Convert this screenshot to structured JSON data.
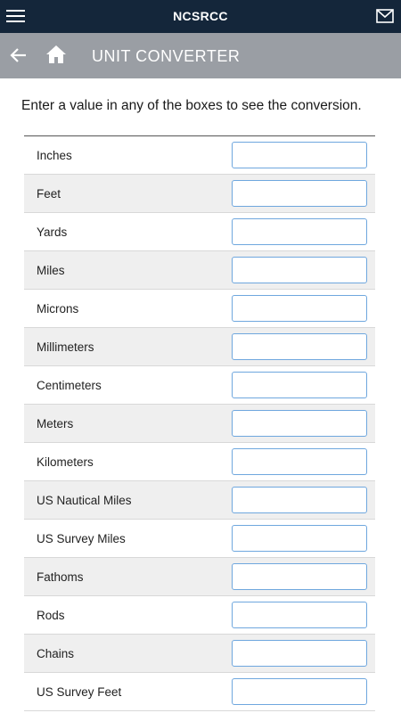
{
  "app": {
    "title": "NCSRCC",
    "menu_icon": "hamburger-icon",
    "mail_icon": "mail-icon"
  },
  "subheader": {
    "back_icon": "back-arrow-icon",
    "home_icon": "home-icon",
    "title": "UNIT CONVERTER"
  },
  "instruction": "Enter a value in any of the boxes to see the conversion.",
  "units": [
    {
      "label": "Inches",
      "value": ""
    },
    {
      "label": "Feet",
      "value": ""
    },
    {
      "label": "Yards",
      "value": ""
    },
    {
      "label": "Miles",
      "value": ""
    },
    {
      "label": "Microns",
      "value": ""
    },
    {
      "label": "Millimeters",
      "value": ""
    },
    {
      "label": "Centimeters",
      "value": ""
    },
    {
      "label": "Meters",
      "value": ""
    },
    {
      "label": "Kilometers",
      "value": ""
    },
    {
      "label": "US Nautical Miles",
      "value": ""
    },
    {
      "label": "US Survey Miles",
      "value": ""
    },
    {
      "label": "Fathoms",
      "value": ""
    },
    {
      "label": "Rods",
      "value": ""
    },
    {
      "label": "Chains",
      "value": ""
    },
    {
      "label": "US Survey Feet",
      "value": ""
    }
  ],
  "colors": {
    "topbar": "#14263a",
    "subbar": "#9a9ea4",
    "input_border": "#6fa7de",
    "row_alt": "#efefef"
  }
}
